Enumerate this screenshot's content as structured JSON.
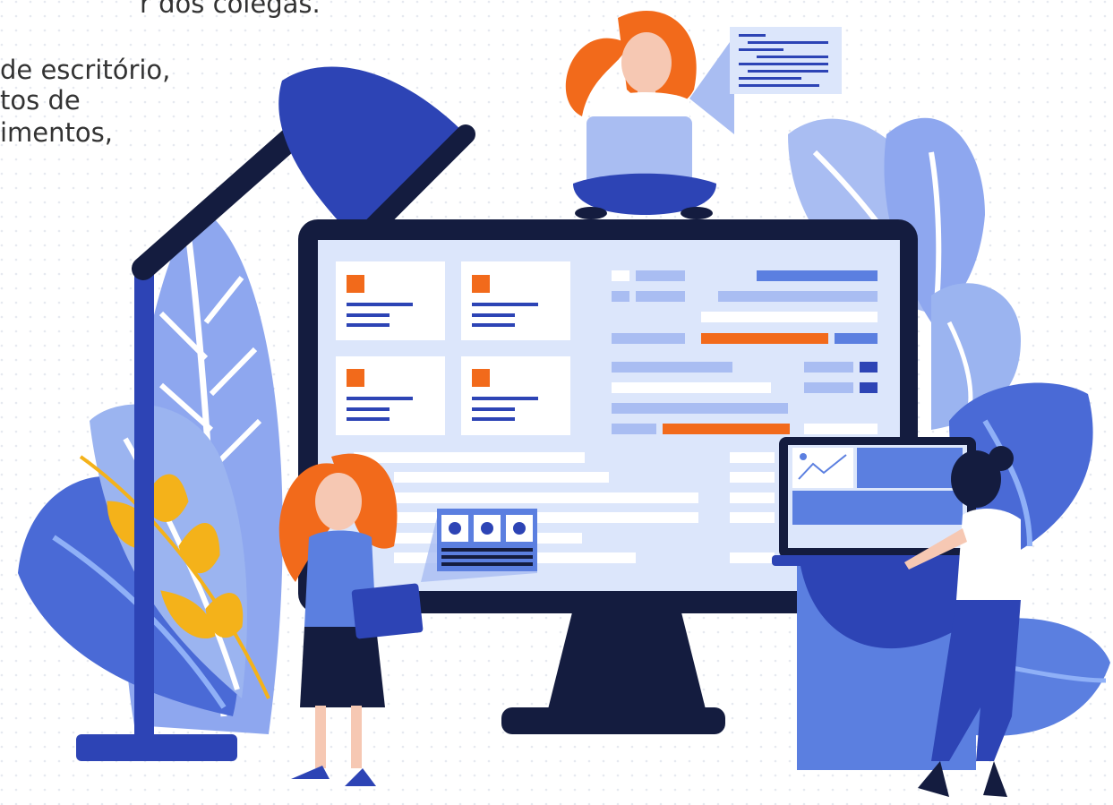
{
  "text_lines": [
    "r dos colegas.",
    "de escritório,",
    "tos de",
    "imentos,"
  ],
  "colors": {
    "navy": "#141c3f",
    "blue": "#2d44b5",
    "mid_blue": "#5b7fe0",
    "light_blue": "#a9bdf2",
    "pale_blue": "#dce6fb",
    "orange": "#f26a1b",
    "gold": "#f4b21a",
    "skin": "#f6c8b3"
  },
  "illustration": {
    "icons": [
      "desk-lamp",
      "monitor",
      "laptop",
      "clipboard",
      "leaf"
    ],
    "figures": [
      "woman-sitting-with-laptop",
      "woman-holding-clipboard",
      "woman-at-laptop"
    ]
  }
}
